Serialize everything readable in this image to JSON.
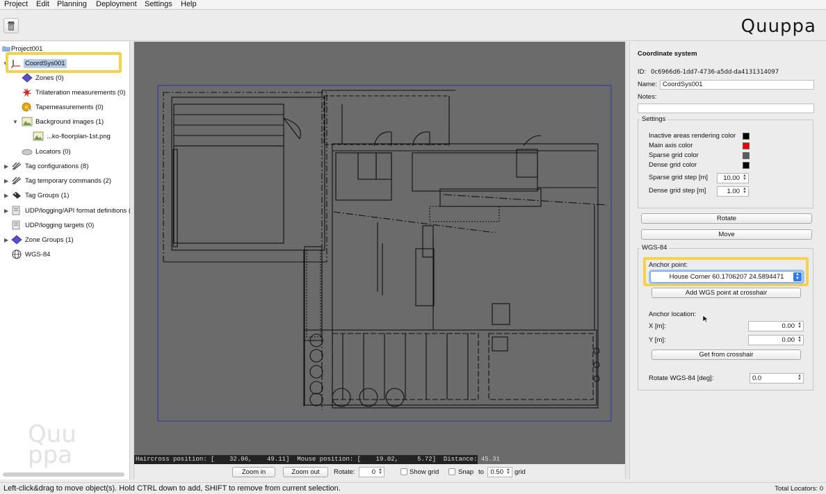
{
  "menu": [
    "Project",
    "Edit",
    "Planning",
    "Deployment",
    "Settings",
    "Help"
  ],
  "brand": "Quuppa",
  "watermark": "Quu\nppa",
  "tree": {
    "root": "Project001",
    "selected": "CoordSys001",
    "items": [
      "Zones (0)",
      "Trilateration measurements (0)",
      "Tapemeasurements (0)",
      "Background images (1)",
      "...ko-floorplan-1st.png",
      "Locators (0)",
      "Tag configurations (8)",
      "Tag temporary commands (2)",
      "Tag Groups (1)",
      "UDP/logging/API format definitions (5",
      "UDP/logging targets (0)",
      "Zone Groups (1)",
      "WGS-84"
    ]
  },
  "canvas": {
    "status": "Haircross position: [    32.06,    49.11]  Mouse position: [    19.02,     5.72]  Distance: 45.31"
  },
  "controls": {
    "zoom_in": "Zoom in",
    "zoom_out": "Zoom out",
    "rotate_label": "Rotate:",
    "rotate_value": "0",
    "show_grid_label": "Show grid",
    "snap_label": "Snap",
    "to_label": "to",
    "snap_value": "0.50",
    "grid_label": "grid"
  },
  "statusbar": {
    "hint": "Left-click&drag to move object(s). Hold CTRL down to add, SHIFT to remove from current selection.",
    "total": "Total Locators: 0"
  },
  "props": {
    "title": "Coordinate system",
    "id_label": "ID:",
    "id_value": "0c6966d6-1dd7-4736-a5dd-da4131314097",
    "name_label": "Name:",
    "name_value": "CoordSys001",
    "notes_label": "Notes:",
    "settings_title": "Settings",
    "inactive_label": "Inactive areas rendering color",
    "main_axis_label": "Main axis color",
    "sparse_color_label": "Sparse grid color",
    "dense_color_label": "Dense grid color",
    "sparse_step_label": "Sparse grid step  [m]",
    "sparse_step_value": "10.00",
    "dense_step_label": "Dense grid step  [m]",
    "dense_step_value": "1.00",
    "rotate_btn": "Rotate",
    "move_btn": "Move",
    "wgs_title": "WGS-84",
    "anchor_label": "Anchor point:",
    "anchor_value": "House Corner 60.1706207 24.5894471",
    "add_wgs_btn": "Add WGS point at crosshair",
    "anchor_loc_label": "Anchor location:",
    "x_label": "X  [m]:",
    "x_value": "0.00",
    "y_label": "Y  [m]:",
    "y_value": "0.00",
    "get_crosshair_btn": "Get from crosshair",
    "rotate_wgs_label": "Rotate WGS-84 [deg]:",
    "rotate_wgs_value": "0.0"
  },
  "colors": {
    "inactive": "#000000",
    "main_axis": "#e8000a",
    "sparse": "#5c5c5c",
    "dense": "#000000",
    "highlight": "#f6d24a",
    "canvas_bg": "#6b6b6b"
  }
}
